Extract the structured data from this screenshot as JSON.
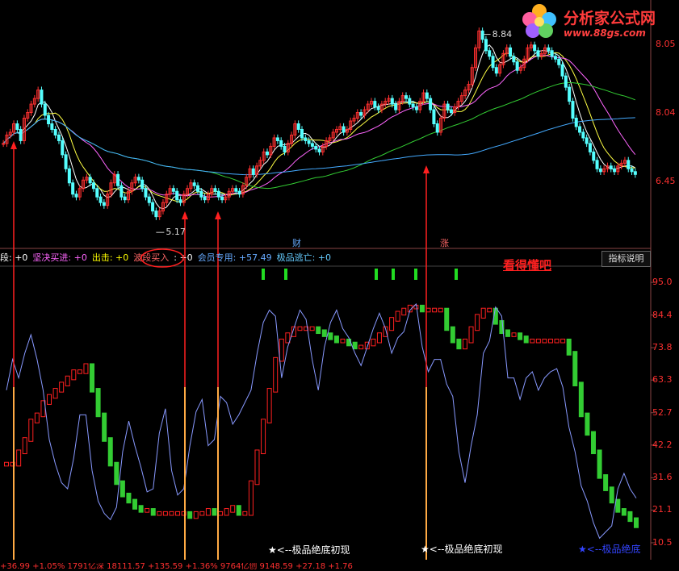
{
  "logo": {
    "title": "分析家公式网",
    "url": "www.88gs.com"
  },
  "price_axis": [
    "8.05",
    "8.04",
    "6.45"
  ],
  "price_annotations": {
    "high": "8.84",
    "low": "5.17"
  },
  "markers": {
    "cai": "财",
    "zhang": "涨"
  },
  "indicator_bar": {
    "items": [
      {
        "text": "段: +0",
        "color": "#ffffff"
      },
      {
        "text": "坚决买进: +0",
        "color": "#ff66ff"
      },
      {
        "text": "出击: +0",
        "color": "#ffff00"
      },
      {
        "text": "波段买入",
        "color": "#ff6666"
      },
      {
        "text": ": +0",
        "color": "#ffffff"
      },
      {
        "text": "会员专用: +57.49",
        "color": "#66aaff"
      },
      {
        "text": "极品逃亡: +0",
        "color": "#66ccff"
      }
    ],
    "help_button": "指标说明"
  },
  "note": "看得懂吧",
  "osc_axis": [
    "95.0",
    "84.4",
    "73.8",
    "63.3",
    "52.7",
    "42.2",
    "31.6",
    "21.1",
    "10.5"
  ],
  "star_labels": [
    {
      "text": "★<--极品绝底初现",
      "color": "#ffffff"
    },
    {
      "text": "★<--极品绝底初现",
      "color": "#ffffff"
    },
    {
      "text": "★<--极品绝底",
      "color": "#3344ff"
    }
  ],
  "bottom_text": "+36.99  +1.05%  1791亿深  18111.57  +135.59  +1.36%  9764亿创  9148.59  +27.18  +1.76",
  "colors": {
    "up": "#ff3030",
    "down": "#55ffff",
    "osc_green": "#33cc33",
    "osc_red": "#ff2020",
    "arrow": "#ff2020",
    "signal": "#ffaa44"
  },
  "chart_data": [
    {
      "type": "candlestick",
      "title": "",
      "ylim": [
        4.9,
        9.3
      ],
      "yticks": [
        8.04,
        6.45
      ],
      "overlays": [
        "MA5",
        "MA10",
        "MA20",
        "MA60",
        "MA120"
      ],
      "annotations": [
        {
          "label": "8.84",
          "index": 138
        },
        {
          "label": "5.17",
          "index": 44
        }
      ],
      "closes": [
        6.75,
        6.9,
        6.95,
        7.1,
        7.0,
        6.8,
        7.2,
        7.3,
        7.45,
        7.55,
        7.7,
        7.45,
        7.25,
        7.1,
        7.0,
        6.9,
        6.8,
        6.55,
        6.3,
        6.05,
        5.85,
        5.8,
        5.95,
        6.1,
        6.15,
        6.05,
        5.95,
        5.8,
        5.7,
        5.65,
        5.85,
        6.05,
        6.2,
        6.0,
        5.8,
        5.75,
        5.9,
        6.05,
        6.15,
        6.1,
        5.95,
        5.8,
        5.7,
        5.55,
        5.45,
        5.55,
        5.7,
        5.85,
        5.95,
        5.9,
        5.75,
        5.7,
        5.85,
        5.95,
        6.05,
        6.0,
        5.9,
        5.8,
        5.75,
        5.85,
        5.95,
        5.9,
        5.8,
        5.75,
        5.8,
        5.9,
        5.95,
        5.9,
        5.85,
        6.0,
        6.15,
        6.3,
        6.2,
        6.35,
        6.45,
        6.6,
        6.55,
        6.7,
        6.85,
        6.8,
        6.7,
        6.6,
        6.75,
        6.9,
        7.1,
        7.0,
        6.85,
        6.8,
        6.75,
        6.7,
        6.65,
        6.6,
        6.7,
        6.8,
        6.85,
        6.95,
        7.0,
        7.05,
        6.95,
        7.0,
        7.15,
        7.2,
        7.3,
        7.25,
        7.35,
        7.45,
        7.5,
        7.4,
        7.35,
        7.45,
        7.5,
        7.55,
        7.45,
        7.35,
        7.5,
        7.6,
        7.55,
        7.45,
        7.4,
        7.35,
        7.5,
        7.65,
        7.55,
        7.35,
        7.1,
        6.95,
        7.2,
        7.45,
        7.35,
        7.3,
        7.4,
        7.5,
        7.6,
        7.7,
        7.8,
        8.1,
        8.45,
        8.75,
        8.6,
        8.4,
        8.3,
        8.1,
        8.0,
        8.15,
        8.35,
        8.45,
        8.3,
        8.2,
        8.05,
        8.1,
        8.25,
        8.45,
        8.5,
        8.4,
        8.3,
        8.35,
        8.45,
        8.4,
        8.3,
        8.25,
        8.15,
        7.95,
        7.75,
        7.5,
        7.2,
        7.05,
        6.95,
        6.85,
        6.75,
        6.6,
        6.45,
        6.3,
        6.25,
        6.3,
        6.35,
        6.3,
        6.25,
        6.35,
        6.4,
        6.45,
        6.3,
        6.25,
        6.2
      ]
    },
    {
      "type": "line",
      "title": "",
      "ylim": [
        5.0,
        100.0
      ],
      "yticks": [
        95.0,
        84.4,
        73.8,
        63.3,
        52.7,
        42.2,
        31.6,
        21.1,
        10.5
      ],
      "series": [
        {
          "name": "",
          "kind": "line",
          "values": [
            60,
            70,
            64,
            72,
            78,
            70,
            60,
            44,
            36,
            30,
            28,
            38,
            52,
            52,
            34,
            24,
            20,
            18,
            22,
            40,
            50,
            42,
            35,
            27,
            28,
            46,
            54,
            34,
            26,
            28,
            42,
            53,
            57,
            42,
            44,
            58,
            56,
            49,
            52,
            56,
            60,
            72,
            82,
            86,
            84,
            64,
            74,
            80,
            86,
            83,
            70,
            60,
            74,
            82,
            86,
            80,
            77,
            72,
            68,
            74,
            80,
            85,
            80,
            72,
            77,
            79,
            86,
            88,
            74,
            66,
            70,
            70,
            62,
            58,
            40,
            30,
            42,
            52,
            72,
            76,
            87,
            84,
            64,
            64,
            57,
            64,
            66,
            60,
            64,
            66,
            67,
            61,
            48,
            40,
            29,
            24,
            17,
            12,
            14,
            16,
            28,
            33,
            28,
            25
          ]
        },
        {
          "name": "",
          "kind": "bars",
          "values": [
            36,
            36,
            40,
            44,
            50,
            52,
            56,
            58,
            60,
            62,
            64,
            66,
            66,
            68,
            60,
            52,
            44,
            36,
            30,
            26,
            24,
            22,
            21,
            21,
            20,
            20,
            20,
            20,
            20,
            20,
            19,
            20,
            20,
            21,
            20,
            20,
            21,
            22,
            20,
            20,
            30,
            40,
            50,
            60,
            70,
            76,
            78,
            80,
            80,
            80,
            80,
            79,
            78,
            77,
            76,
            76,
            75,
            74,
            74,
            75,
            76,
            78,
            80,
            83,
            85,
            86,
            87,
            87,
            86,
            86,
            86,
            86,
            80,
            76,
            74,
            76,
            80,
            84,
            86,
            86,
            82,
            79,
            78,
            78,
            77,
            76,
            76,
            76,
            76,
            76,
            76,
            76,
            72,
            62,
            52,
            46,
            40,
            32,
            28,
            24,
            21,
            20,
            18,
            16
          ]
        }
      ]
    }
  ]
}
